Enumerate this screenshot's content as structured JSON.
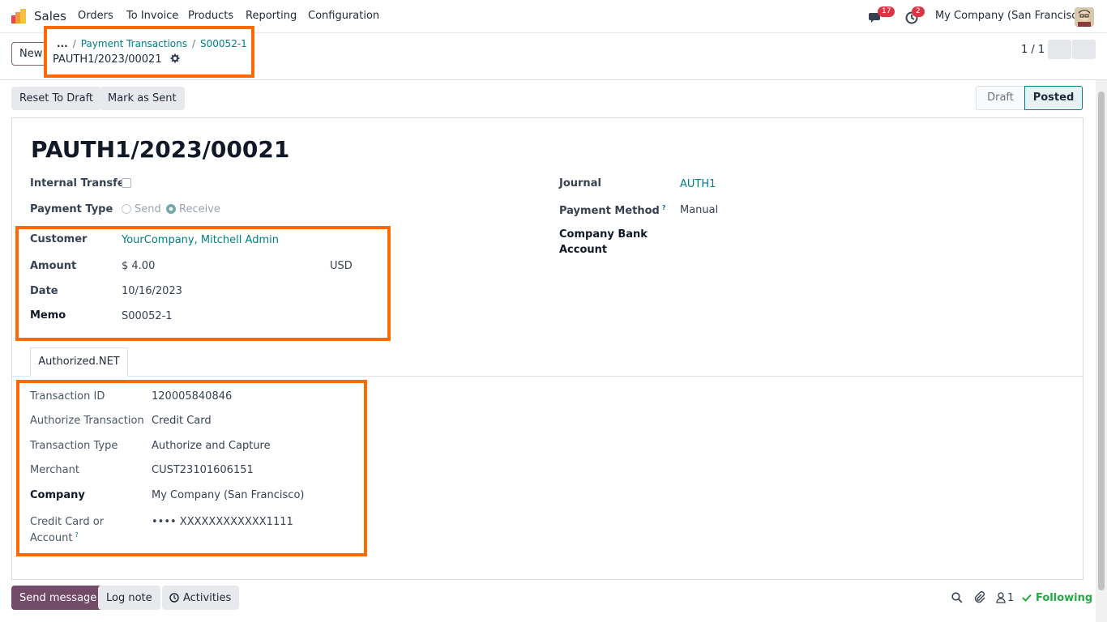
{
  "app": {
    "name": "Sales",
    "menu": [
      "Orders",
      "To Invoice",
      "Products",
      "Reporting",
      "Configuration"
    ],
    "messages_count": "17",
    "activities_count": "2",
    "company": "My Company (San Francisco)"
  },
  "control": {
    "new_label": "New",
    "breadcrumb_ellipsis": "...",
    "breadcrumb_1": "Payment Transactions",
    "breadcrumb_2": "S00052-1",
    "record_name": "PAUTH1/2023/00021",
    "pager": "1 / 1"
  },
  "actions": {
    "reset_to_draft": "Reset To Draft",
    "mark_as_sent": "Mark as Sent",
    "status_draft": "Draft",
    "status_posted": "Posted"
  },
  "form": {
    "title": "PAUTH1/2023/00021",
    "internal_transfer_label": "Internal Transfer",
    "payment_type_label": "Payment Type",
    "payment_type_send": "Send",
    "payment_type_receive": "Receive",
    "customer_label": "Customer",
    "customer_value": "YourCompany, Mitchell Admin",
    "amount_label": "Amount",
    "amount_value": "$ 4.00",
    "currency_value": "USD",
    "date_label": "Date",
    "date_value": "10/16/2023",
    "memo_label": "Memo",
    "memo_value": "S00052-1",
    "journal_label": "Journal",
    "journal_value": "AUTH1",
    "payment_method_label": "Payment Method",
    "payment_method_value": "Manual",
    "company_bank_label_1": "Company Bank",
    "company_bank_label_2": "Account"
  },
  "tab": {
    "label": "Authorized.NET"
  },
  "authorize": {
    "transaction_id_label": "Transaction ID",
    "transaction_id_value": "120005840846",
    "authorize_transaction_label": "Authorize Transaction",
    "authorize_transaction_value": "Credit Card",
    "transaction_type_label": "Transaction Type",
    "transaction_type_value": "Authorize and Capture",
    "merchant_label": "Merchant",
    "merchant_value": "CUST23101606151",
    "company_label": "Company",
    "company_value": "My Company (San Francisco)",
    "card_label_1": "Credit Card or",
    "card_label_2": "Account",
    "card_value": "•••• XXXXXXXXXXXX1111"
  },
  "chatter": {
    "send_message": "Send message",
    "log_note": "Log note",
    "activities": "Activities",
    "followers_count": "1",
    "following": "Following"
  },
  "colors": {
    "highlight": "#ff6a00",
    "link": "#017e84",
    "primary": "#714b67",
    "following": "#28a745"
  }
}
